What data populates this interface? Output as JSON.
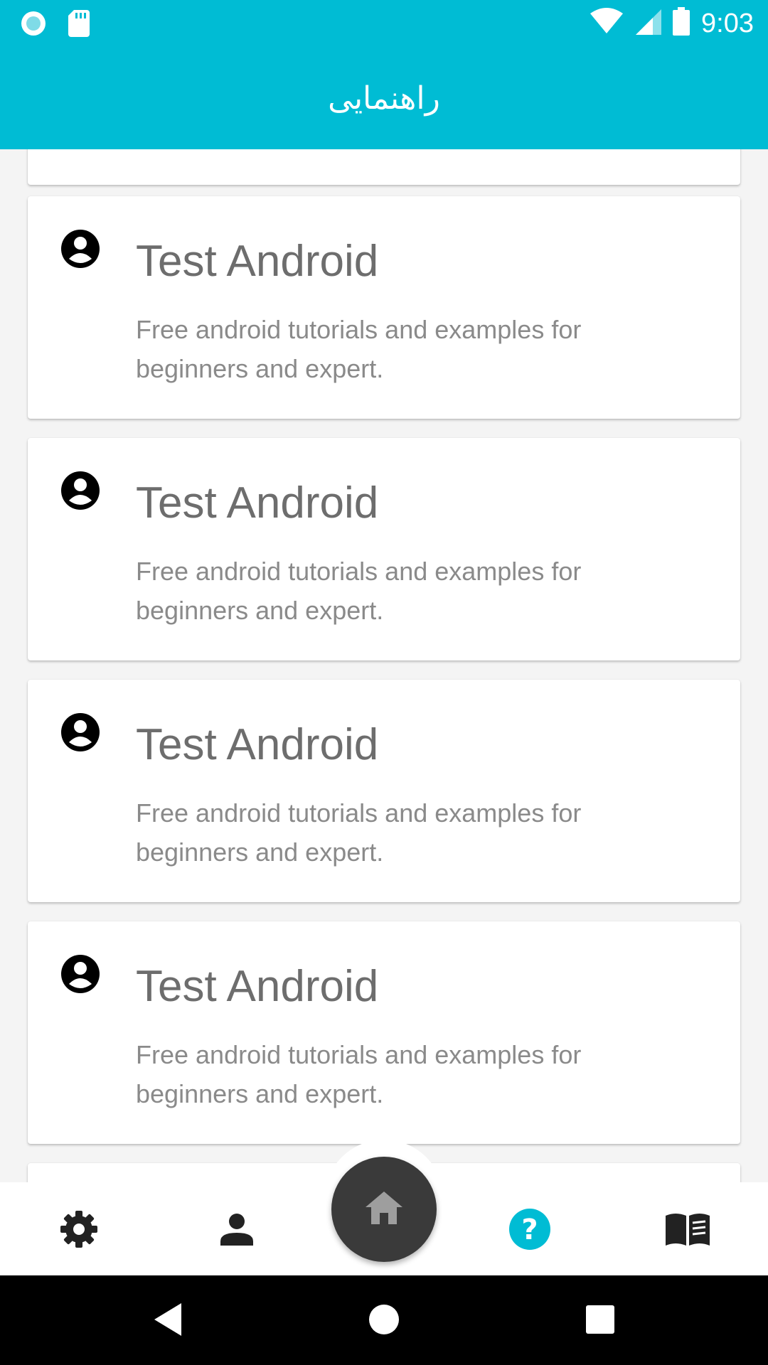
{
  "status_bar": {
    "time": "9:03",
    "icons": [
      "notification-circle-icon",
      "sd-card-icon",
      "wifi-icon",
      "cell-signal-icon",
      "battery-icon"
    ]
  },
  "app_bar": {
    "title": "راهنمایی"
  },
  "cards": [
    {
      "title": "Test Android",
      "description": "Free android tutorials and examples for beginners and expert.",
      "icon": "account-circle-icon"
    },
    {
      "title": "Test Android",
      "description": "Free android tutorials and examples for beginners and expert.",
      "icon": "account-circle-icon"
    },
    {
      "title": "Test Android",
      "description": "Free android tutorials and examples for beginners and expert.",
      "icon": "account-circle-icon"
    },
    {
      "title": "Test Android",
      "description": "Free android tutorials and examples for beginners and expert.",
      "icon": "account-circle-icon"
    }
  ],
  "bottom_nav": {
    "items": [
      "settings-icon",
      "person-icon",
      "home-icon",
      "help-icon",
      "book-icon"
    ],
    "active": "help-icon",
    "active_color": "#00bcd4"
  },
  "colors": {
    "primary": "#00bcd4",
    "fab": "#3a3a3a"
  },
  "system_nav": [
    "back-icon",
    "home-circle-icon",
    "recents-icon"
  ]
}
